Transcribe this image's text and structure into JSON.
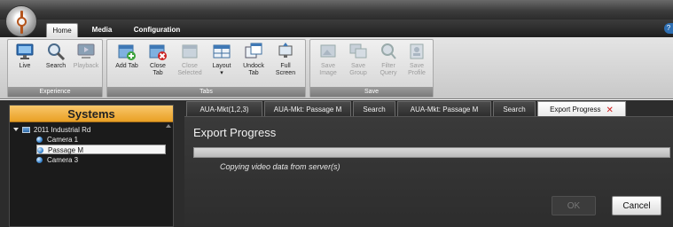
{
  "ribbon_tabs": [
    {
      "label": "Home",
      "active": true
    },
    {
      "label": "Media",
      "active": false
    },
    {
      "label": "Configuration",
      "active": false
    }
  ],
  "ribbon": {
    "groups": {
      "experience": {
        "label": "Experience"
      },
      "tabs": {
        "label": "Tabs"
      },
      "save": {
        "label": "Save"
      }
    },
    "buttons": {
      "live": {
        "label": "Live",
        "icon": "monitor-icon",
        "enabled": true
      },
      "search": {
        "label": "Search",
        "icon": "magnifier-icon",
        "enabled": true
      },
      "playback": {
        "label": "Playback",
        "icon": "playback-monitor-icon",
        "enabled": false
      },
      "add_tab": {
        "label": "Add Tab",
        "icon": "add-tab-icon",
        "enabled": true
      },
      "close_tab": {
        "label": "Close\nTab",
        "icon": "close-tab-icon",
        "enabled": true
      },
      "close_selected": {
        "label": "Close\nSelected",
        "icon": "close-selected-icon",
        "enabled": false
      },
      "layout": {
        "label": "Layout",
        "icon": "layout-grid-icon",
        "enabled": true
      },
      "undock_tab": {
        "label": "Undock\nTab",
        "icon": "undock-icon",
        "enabled": true
      },
      "full_screen": {
        "label": "Full\nScreen",
        "icon": "fullscreen-icon",
        "enabled": true
      },
      "save_image": {
        "label": "Save\nImage",
        "icon": "save-image-icon",
        "enabled": false
      },
      "save_group": {
        "label": "Save\nGroup",
        "icon": "save-group-icon",
        "enabled": false
      },
      "filter_query": {
        "label": "Filter\nQuery",
        "icon": "filter-icon",
        "enabled": false
      },
      "save_profile": {
        "label": "Save\nProfile",
        "icon": "save-profile-icon",
        "enabled": false
      }
    }
  },
  "systems": {
    "title": "Systems",
    "site": {
      "label": "2011 Industrial Rd",
      "icon": "site-icon",
      "expanded": true
    },
    "cameras": [
      {
        "label": "Camera 1",
        "selected": false
      },
      {
        "label": "Passage M",
        "selected": true
      },
      {
        "label": "Camera 3",
        "selected": false
      }
    ]
  },
  "doc_tabs": [
    {
      "label": "AUA-Mkt(1,2,3)",
      "active": false
    },
    {
      "label": "AUA-Mkt: Passage M",
      "active": false
    },
    {
      "label": "Search",
      "active": false
    },
    {
      "label": "AUA-Mkt: Passage M",
      "active": false
    },
    {
      "label": "Search",
      "active": false
    },
    {
      "label": "Export Progress",
      "active": true,
      "closable": true
    }
  ],
  "export": {
    "heading": "Export Progress",
    "progress": 0.0,
    "status": "Copying video data from server(s)",
    "ok_label": "OK",
    "ok_enabled": false,
    "cancel_label": "Cancel"
  },
  "colors": {
    "systems_header": "#e9a025",
    "dark_background": "#2c2c2c",
    "close_x": "#d02020"
  }
}
